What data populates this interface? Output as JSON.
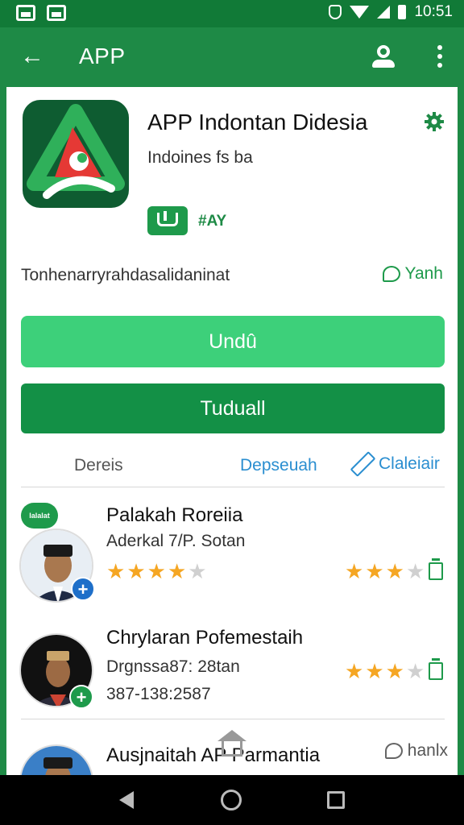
{
  "status_bar": {
    "time": "10:51",
    "icons": [
      "gallery-icon",
      "image-icon",
      "shield-icon",
      "wifi-icon",
      "signal-icon",
      "battery-icon"
    ]
  },
  "app_bar": {
    "title": "APP",
    "icons": [
      "back-arrow-icon",
      "account-icon",
      "more-vert-icon"
    ]
  },
  "app_info": {
    "name": "APP Indontan Didesia",
    "subtitle": "Indoines fs ba",
    "badge_text": "#AY",
    "description": "Tonhenarryrahdasalidaninat",
    "link_label": "Yanh"
  },
  "buttons": {
    "primary_label": "Undû",
    "secondary_label": "Tuduall"
  },
  "tabs": {
    "details": "Dereis",
    "dep": "Depseuah",
    "cal": "Claleiair"
  },
  "reviews": [
    {
      "name": "Palakah Roreiia",
      "subtitle": "Aderkal 7/P. Sotan",
      "detail": "",
      "left_rating": 4.5,
      "right_rating": 3.5,
      "chat_badge": "lalalat"
    },
    {
      "name": "Chrylaran Pofemestaih",
      "subtitle": "Drgnssa87: 28tan",
      "detail": "387-138:2587",
      "left_rating": null,
      "right_rating": 3.5
    },
    {
      "name": "Ausjnaitah AP Parmantia",
      "subtitle": "",
      "detail": "",
      "link_label": "hanlx"
    }
  ],
  "colors": {
    "brand_green": "#1e8a46",
    "status_green": "#117a37",
    "button_light_green": "#3dd07a",
    "button_dark_green": "#139046",
    "link_blue": "#2a8ed0",
    "star_gold": "#f5a623"
  }
}
